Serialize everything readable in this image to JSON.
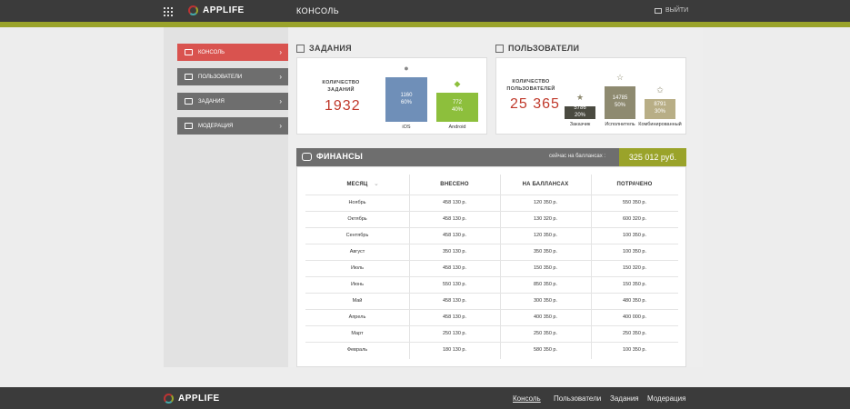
{
  "header": {
    "logo_text": "APPLIFE",
    "title": "КОНСОЛЬ",
    "logout_label": "ВЫЙТИ"
  },
  "sidebar": {
    "items": [
      {
        "label": "КОНСОЛЬ",
        "active": true
      },
      {
        "label": "ПОЛЬЗОВАТЕЛИ",
        "active": false
      },
      {
        "label": "ЗАДАНИЯ",
        "active": false
      },
      {
        "label": "МОДЕРАЦИЯ",
        "active": false
      }
    ]
  },
  "tasks": {
    "title": "ЗАДАНИЯ",
    "count_label": "КОЛИЧЕСТВО ЗАДАНИЙ",
    "count_value": "1932",
    "bars": [
      {
        "name": "iOS",
        "count": "1160",
        "percent": "60%",
        "share": 0.6,
        "color": "#6f8fb8",
        "icon": "apple-icon"
      },
      {
        "name": "Android",
        "count": "772",
        "percent": "40%",
        "share": 0.4,
        "color": "#8dbf3c",
        "icon": "android-icon"
      }
    ]
  },
  "users": {
    "title": "ПОЛЬЗОВАТЕЛИ",
    "count_label": "КОЛИЧЕСТВО ПОЛЬЗОВАТЕЛЕЙ",
    "count_value": "25 365",
    "bars": [
      {
        "name": "Заказчик",
        "count": "5786",
        "percent": "20%",
        "share": 0.2,
        "color": "#4a4a40",
        "icon": "star-filled-icon"
      },
      {
        "name": "Исполнитель",
        "count": "14785",
        "percent": "50%",
        "share": 0.5,
        "color": "#8e8a70",
        "icon": "star-outline-icon"
      },
      {
        "name": "Комбинированный",
        "count": "8791",
        "percent": "30%",
        "share": 0.3,
        "color": "#b8ae86",
        "icon": "star-half-icon"
      }
    ]
  },
  "finance": {
    "title": "ФИНАНСЫ",
    "balance_label": "сейчас на баллансах :",
    "balance_value": "325 012 руб.",
    "columns": [
      "МЕСЯЦ",
      "ВНЕСЕНО",
      "НА БАЛЛАНСАХ",
      "ПОТРАЧЕНО"
    ],
    "rows": [
      [
        "Ноябрь",
        "458 130 р.",
        "120 350 р.",
        "550 350 р."
      ],
      [
        "Октябрь",
        "458 130 р.",
        "130 320 р.",
        "600 320 р."
      ],
      [
        "Сентябрь",
        "458 130 р.",
        "120 350 р.",
        "100 350 р."
      ],
      [
        "Август",
        "350 130 р.",
        "350 350 р.",
        "100 350 р."
      ],
      [
        "Июль",
        "458 130 р.",
        "150 350 р.",
        "150 320 р."
      ],
      [
        "Июнь",
        "550 130 р.",
        "850 350 р.",
        "150 350 р."
      ],
      [
        "Май",
        "458 130 р.",
        "300 350 р.",
        "480 350 р."
      ],
      [
        "Апрель",
        "458 130 р.",
        "400 350 р.",
        "400 000 р."
      ],
      [
        "Март",
        "250 130 р.",
        "250 350 р.",
        "250 350 р."
      ],
      [
        "Февраль",
        "180 130 р.",
        "580 350 р.",
        "100 350 р."
      ]
    ]
  },
  "footer": {
    "logo_text": "APPLIFE",
    "links": [
      "Консоль",
      "Пользователи",
      "Задания",
      "Модерация"
    ]
  }
}
